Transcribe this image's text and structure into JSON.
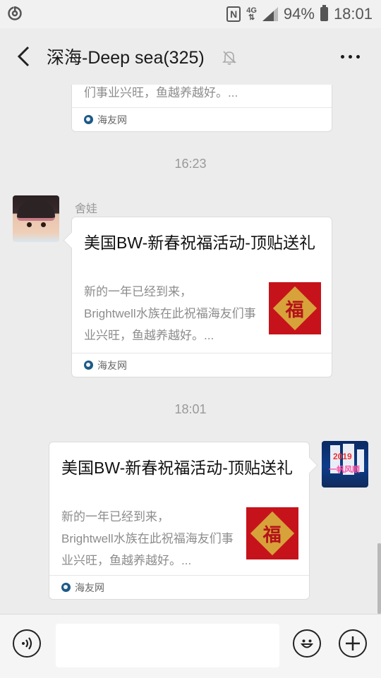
{
  "status_bar": {
    "signal_label": "4G",
    "battery": "94%",
    "time": "18:01"
  },
  "header": {
    "title": "深海-Deep sea(325)"
  },
  "messages": [
    {
      "type": "link_card_partial",
      "desc_tail": "们事业兴旺，鱼越养越好。...",
      "source": "海友网"
    },
    {
      "type": "timestamp",
      "text": "16:23"
    },
    {
      "type": "link_card",
      "sender": "舍娃",
      "title": "美国BW-新春祝福活动-顶贴送礼",
      "desc": "新的一年已经到来，\nBrightwell水族在此祝福海友们事业兴旺，鱼越养越好。...",
      "thumb_char": "福",
      "source": "海友网"
    },
    {
      "type": "timestamp",
      "text": "18:01"
    },
    {
      "type": "link_card_self",
      "title": "美国BW-新春祝福活动-顶贴送礼",
      "desc": "新的一年已经到来，\nBrightwell水族在此祝福海友们事业兴旺，鱼越养越好。...",
      "thumb_char": "福",
      "source": "海友网",
      "avatar_text": [
        "2019",
        "一帆风顺"
      ]
    }
  ],
  "input_bar": {
    "placeholder": "",
    "icons": [
      "voice-icon",
      "emoji-icon",
      "plus-icon"
    ]
  },
  "colors": {
    "background": "#ececec",
    "card": "#ffffff",
    "thumb_red": "#c6131b",
    "source_icon": "#1c5a88"
  }
}
